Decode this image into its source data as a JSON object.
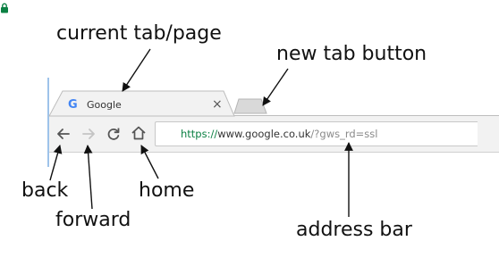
{
  "labels": {
    "current_tab": "current tab/page",
    "new_tab": "new tab button",
    "back": "back",
    "forward": "forward",
    "home": "home",
    "address_bar": "address bar"
  },
  "browser": {
    "tab_title": "Google",
    "tab_close": "×",
    "google_letter": "G",
    "url_scheme": "https://",
    "url_host": "www.google.co.uk",
    "url_path": "/?gws_rd=ssl"
  },
  "colors": {
    "secure_green": "#0b8043",
    "tab_fill": "#f2f2f2",
    "new_tab_fill": "#d9d9d9",
    "accent_line": "#9ec3ea"
  },
  "icons": [
    "back-arrow-icon",
    "forward-arrow-icon",
    "reload-icon",
    "home-icon",
    "lock-icon",
    "close-icon"
  ]
}
